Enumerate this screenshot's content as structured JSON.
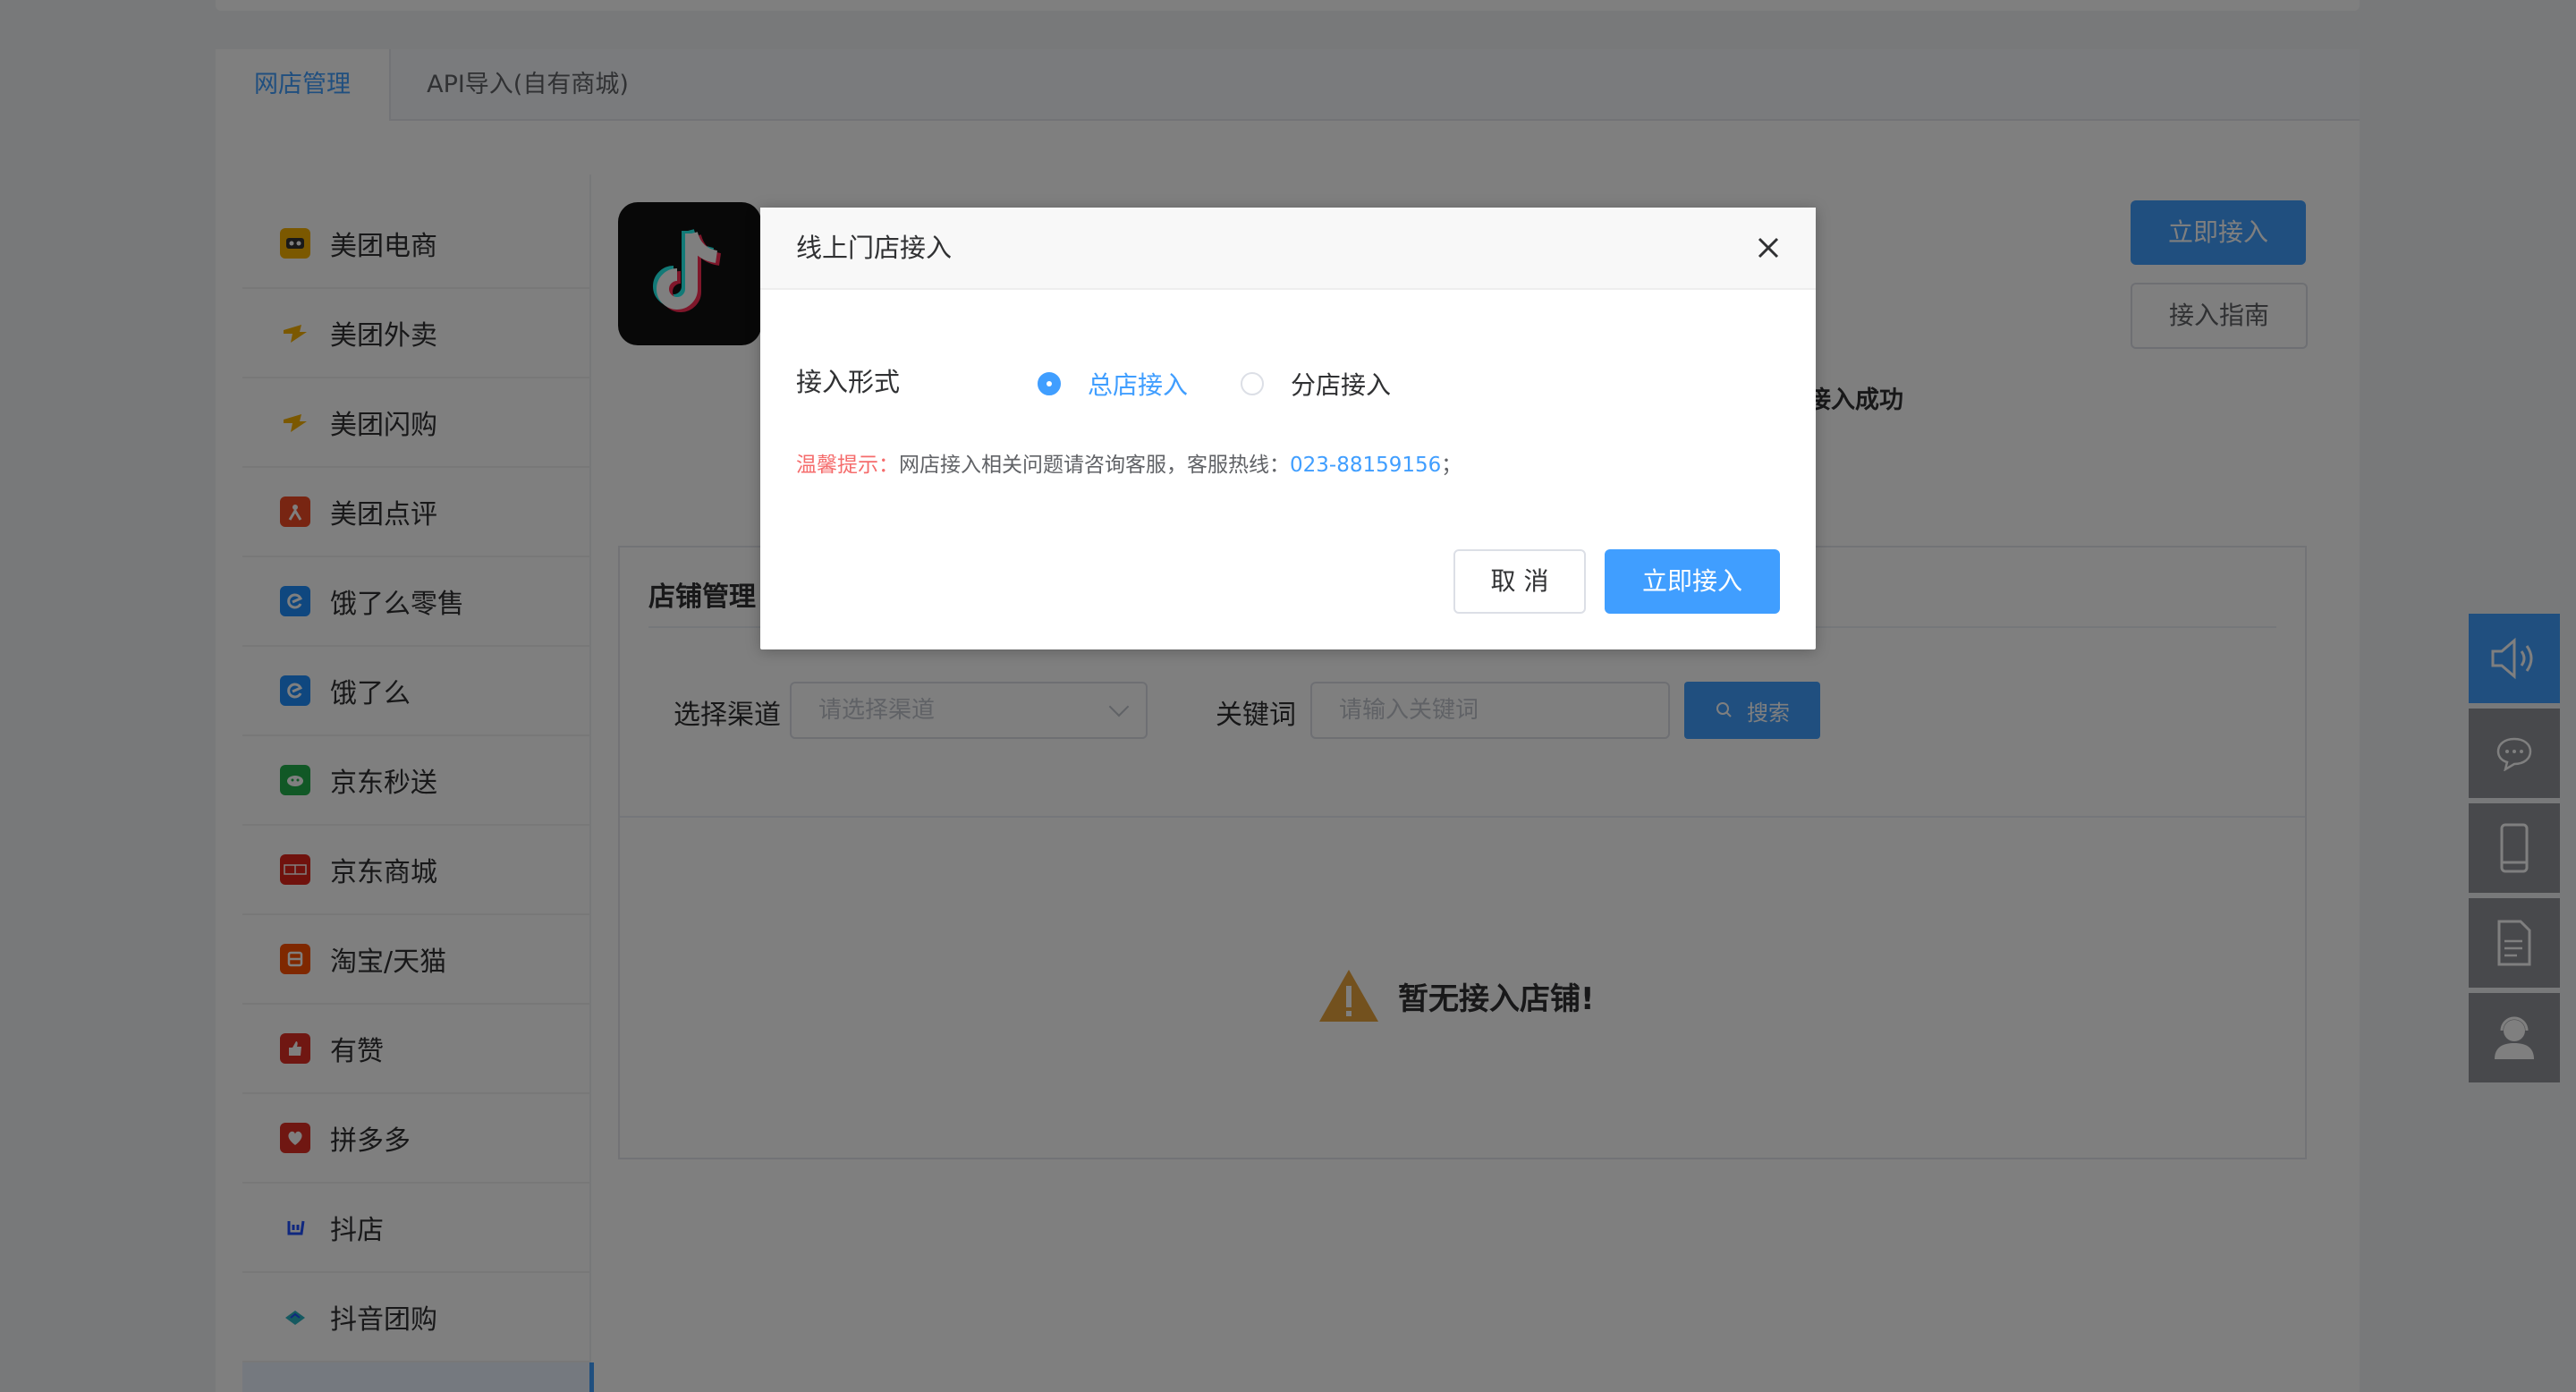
{
  "tabs": [
    {
      "label": "网店管理"
    },
    {
      "label": "API导入(自有商城)"
    }
  ],
  "sidebar": {
    "items": [
      {
        "label": "美团电商",
        "icon": "meituan-ecommerce-icon",
        "color": "#f6b100"
      },
      {
        "label": "美团外卖",
        "icon": "meituan-waimai-icon",
        "color": "#f6b100"
      },
      {
        "label": "美团闪购",
        "icon": "meituan-shangou-icon",
        "color": "#f6b100"
      },
      {
        "label": "美团点评",
        "icon": "meituan-dianping-icon",
        "color": "#f04a24"
      },
      {
        "label": "饿了么零售",
        "icon": "eleme-retail-icon",
        "color": "#1e8fff"
      },
      {
        "label": "饿了么",
        "icon": "eleme-icon",
        "color": "#1e8fff"
      },
      {
        "label": "京东秒送",
        "icon": "jd-miaosong-icon",
        "color": "#23b14d"
      },
      {
        "label": "京东商城",
        "icon": "jd-mall-icon",
        "color": "#e1251b"
      },
      {
        "label": "淘宝/天猫",
        "icon": "taobao-icon",
        "color": "#ff5000"
      },
      {
        "label": "有赞",
        "icon": "youzan-icon",
        "color": "#e02e24"
      },
      {
        "label": "拼多多",
        "icon": "pinduoduo-icon",
        "color": "#e02e24"
      },
      {
        "label": "抖店",
        "icon": "doudian-icon",
        "color": "#1e4fff"
      },
      {
        "label": "抖音团购",
        "icon": "douyin-groupbuy-icon",
        "color": "#2bb3c0"
      }
    ]
  },
  "header": {
    "connect_button": "立即接入",
    "guide_button": "接入指南",
    "success_text": "接入成功"
  },
  "store": {
    "title": "店铺管理",
    "channel_label": "选择渠道",
    "channel_placeholder": "请选择渠道",
    "keyword_label": "关键词",
    "keyword_placeholder": "请输入关键词",
    "search_button": "搜索",
    "empty_text": "暂无接入店铺!"
  },
  "modal": {
    "title": "线上门店接入",
    "form_label": "接入形式",
    "options": [
      {
        "label": "总店接入",
        "checked": true
      },
      {
        "label": "分店接入",
        "checked": false
      }
    ],
    "tip_label": "温馨提示：",
    "tip_text": "网店接入相关问题请咨询客服，客服热线：",
    "tip_phone": "023-88159156",
    "tip_end": "；",
    "cancel_button": "取 消",
    "confirm_button": "立即接入"
  },
  "colors": {
    "primary": "#409eff",
    "warning": "#e6a23c",
    "danger": "#f56c6c"
  }
}
